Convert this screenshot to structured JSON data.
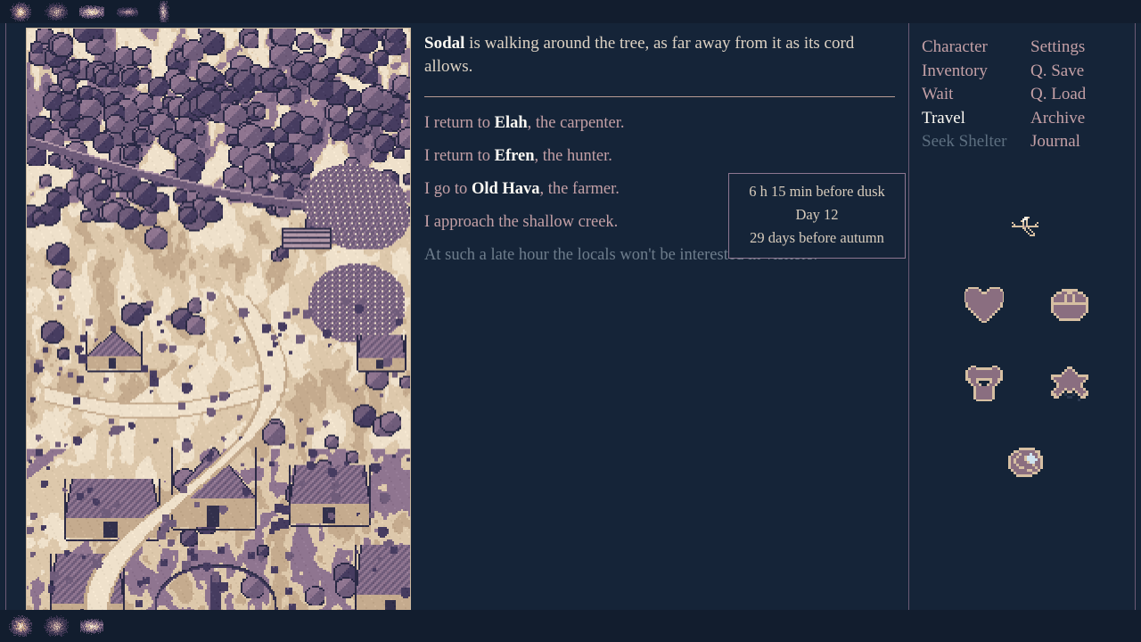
{
  "theme": {
    "bg": "#152438",
    "bg_dark": "#121d2e",
    "text_primary": "#ded3c4",
    "text_bright": "#fdfaf3",
    "text_choice": "#c4a0a6",
    "text_disabled": "#6e7d8c",
    "border_frame": "#6b5a74",
    "border_map": "#c9b79f",
    "border_tooltip": "#8d7690",
    "icon_fill": "#8a6e80",
    "icon_outline": "#d6bfa2"
  },
  "story": {
    "prose_lead": "Sodal",
    "prose_rest": " is walking around the tree, as far away from it as its cord allows.",
    "choices": [
      {
        "pre": "I return to ",
        "name": "Elah",
        "post": ", the carpenter.",
        "disabled": false
      },
      {
        "pre": "I return to ",
        "name": "Efren",
        "post": ", the hunter.",
        "disabled": false
      },
      {
        "pre": "I go to ",
        "name": "Old Hava",
        "post": ", the farmer.",
        "disabled": false
      },
      {
        "pre": "I approach the shallow creek.",
        "name": "",
        "post": "",
        "disabled": false
      },
      {
        "pre": "At such a late hour the locals won't be interested in visitors.",
        "name": "",
        "post": "",
        "disabled": true
      }
    ]
  },
  "time_box": {
    "line1": "6 h 15 min before dusk",
    "line2": "Day 12",
    "line3": "29 days before autumn"
  },
  "menu": {
    "left_column": [
      {
        "label": "Character",
        "state": "normal"
      },
      {
        "label": "Inventory",
        "state": "normal"
      },
      {
        "label": "Wait",
        "state": "normal"
      },
      {
        "label": "Travel",
        "state": "active"
      },
      {
        "label": "Seek Shelter",
        "state": "disabled"
      }
    ],
    "right_column": [
      {
        "label": "Settings",
        "state": "normal"
      },
      {
        "label": "Q. Save",
        "state": "normal"
      },
      {
        "label": "Q. Load",
        "state": "normal"
      },
      {
        "label": "Archive",
        "state": "normal"
      },
      {
        "label": "Journal",
        "state": "normal"
      }
    ]
  },
  "status_icons": [
    {
      "name": "sundial-icon",
      "row": 0,
      "slot": 0
    },
    {
      "name": "heart-icon",
      "row": 1,
      "slot": 0
    },
    {
      "name": "basket-icon",
      "row": 1,
      "slot": 1
    },
    {
      "name": "shirt-icon",
      "row": 2,
      "slot": 0
    },
    {
      "name": "star-icon",
      "row": 2,
      "slot": 1
    },
    {
      "name": "moon-orb-icon",
      "row": 3,
      "slot": 0
    }
  ],
  "quickbar_top": [
    {
      "name": "shell-item-icon"
    },
    {
      "name": "stone-item-icon"
    },
    {
      "name": "pelt-item-icon"
    },
    {
      "name": "bark-item-icon"
    },
    {
      "name": "figure-item-icon"
    }
  ],
  "quickbar_bottom": [
    {
      "name": "axe-tool-icon"
    },
    {
      "name": "backpack-icon"
    },
    {
      "name": "logs-item-icon"
    }
  ],
  "map": {
    "label": "village-map",
    "seed": 20250612
  }
}
